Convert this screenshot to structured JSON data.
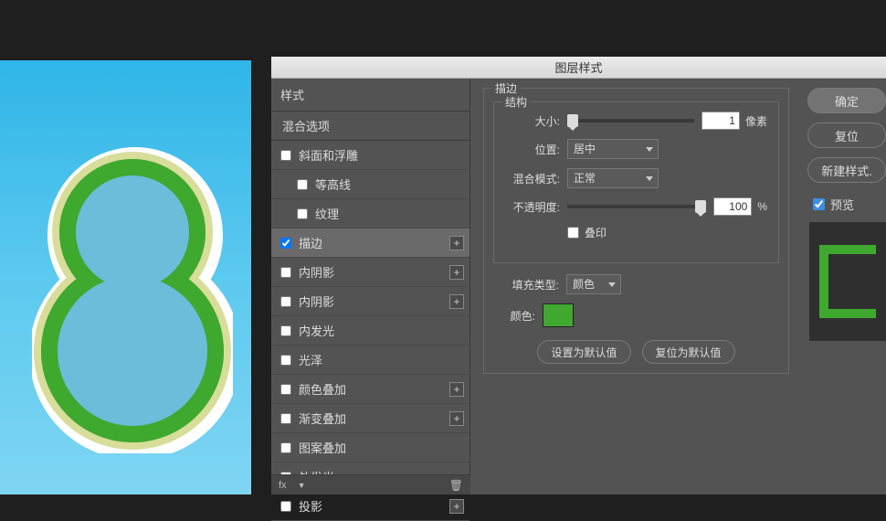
{
  "dialog": {
    "title": "图层样式"
  },
  "styles_panel": {
    "header": "样式",
    "blend_options": "混合选项",
    "items": [
      {
        "label": "斜面和浮雕",
        "checked": false,
        "plus": false
      },
      {
        "label": "等高线",
        "checked": false,
        "plus": false,
        "indent": true
      },
      {
        "label": "纹理",
        "checked": false,
        "plus": false,
        "indent": true
      },
      {
        "label": "描边",
        "checked": true,
        "plus": true,
        "selected": true
      },
      {
        "label": "内阴影",
        "checked": false,
        "plus": true
      },
      {
        "label": "内阴影",
        "checked": false,
        "plus": true
      },
      {
        "label": "内发光",
        "checked": false,
        "plus": false
      },
      {
        "label": "光泽",
        "checked": false,
        "plus": false
      },
      {
        "label": "颜色叠加",
        "checked": false,
        "plus": true
      },
      {
        "label": "渐变叠加",
        "checked": false,
        "plus": true
      },
      {
        "label": "图案叠加",
        "checked": false,
        "plus": false
      },
      {
        "label": "外发光",
        "checked": false,
        "plus": false
      },
      {
        "label": "投影",
        "checked": false,
        "plus": true
      }
    ],
    "bottom_fx": "fx"
  },
  "stroke": {
    "section_title": "描边",
    "structure_title": "结构",
    "size_label": "大小:",
    "size_value": "1",
    "size_unit": "像素",
    "position_label": "位置:",
    "position_value": "居中",
    "blend_label": "混合模式:",
    "blend_value": "正常",
    "opacity_label": "不透明度:",
    "opacity_value": "100",
    "opacity_unit": "%",
    "overprint_label": "叠印",
    "fill_type_label": "填充类型:",
    "fill_type_value": "颜色",
    "color_label": "颜色:",
    "color_hex": "#3fa82f",
    "defaults_btn": "设置为默认值",
    "reset_btn": "复位为默认值"
  },
  "actions": {
    "ok": "确定",
    "cancel": "复位",
    "new_style": "新建样式.",
    "preview_label": "预览"
  }
}
